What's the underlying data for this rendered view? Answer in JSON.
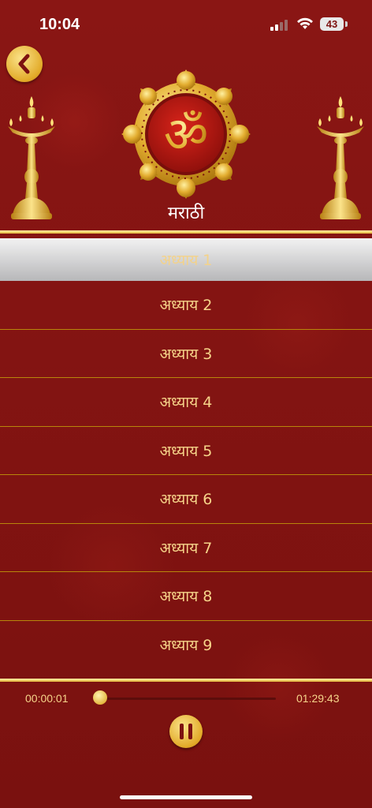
{
  "status_bar": {
    "time": "10:04",
    "battery": "43"
  },
  "header": {
    "back_icon": "chevron-left-icon",
    "emblem_icon": "om-icon",
    "om_symbol": "ॐ",
    "lamp_icon": "oil-lamp-icon",
    "title": "मराठी"
  },
  "chapters": [
    {
      "label": "अध्याय 1",
      "selected": true
    },
    {
      "label": "अध्याय 2",
      "selected": false
    },
    {
      "label": "अध्याय 3",
      "selected": false
    },
    {
      "label": "अध्याय 4",
      "selected": false
    },
    {
      "label": "अध्याय 5",
      "selected": false
    },
    {
      "label": "अध्याय 6",
      "selected": false
    },
    {
      "label": "अध्याय 7",
      "selected": false
    },
    {
      "label": "अध्याय 8",
      "selected": false
    },
    {
      "label": "अध्याय 9",
      "selected": false
    }
  ],
  "player": {
    "current_time": "00:00:01",
    "total_time": "01:29:43",
    "progress": 0.0,
    "control_icon": "pause-icon"
  },
  "colors": {
    "background": "#7d1210",
    "gold": "#e2aa28",
    "text_gold": "#f6d48a"
  }
}
